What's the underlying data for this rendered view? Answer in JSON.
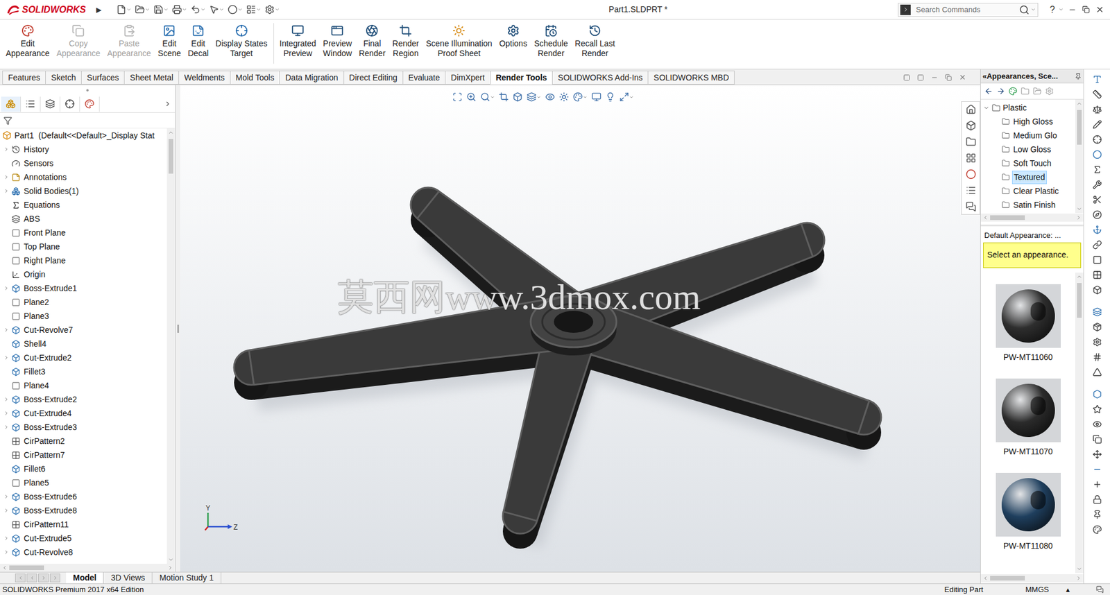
{
  "title_bar": {
    "logo": "SOLIDWORKS",
    "menu_arrow": "▶",
    "document": "Part1.SLDPRT *",
    "search_placeholder": "Search Commands",
    "help": "?"
  },
  "ribbon": [
    {
      "lines": [
        "Edit",
        "Appearance"
      ],
      "disabled": false
    },
    {
      "lines": [
        "Copy",
        "Appearance"
      ],
      "disabled": true
    },
    {
      "lines": [
        "Paste",
        "Appearance"
      ],
      "disabled": true
    },
    {
      "lines": [
        "Edit",
        "Scene"
      ],
      "disabled": false
    },
    {
      "lines": [
        "Edit",
        "Decal"
      ],
      "disabled": false
    },
    {
      "lines": [
        "Display States",
        "Target"
      ],
      "disabled": false
    },
    {
      "lines": [
        "Integrated",
        "Preview"
      ],
      "disabled": false
    },
    {
      "lines": [
        "Preview",
        "Window"
      ],
      "disabled": false
    },
    {
      "lines": [
        "Final",
        "Render"
      ],
      "disabled": false
    },
    {
      "lines": [
        "Render",
        "Region"
      ],
      "disabled": false
    },
    {
      "lines": [
        "Scene Illumination",
        "Proof Sheet"
      ],
      "disabled": false
    },
    {
      "lines": [
        "Options"
      ],
      "disabled": false
    },
    {
      "lines": [
        "Schedule",
        "Render"
      ],
      "disabled": false
    },
    {
      "lines": [
        "Recall Last",
        "Render"
      ],
      "disabled": false
    }
  ],
  "tabs": [
    {
      "label": "Features",
      "selected": false
    },
    {
      "label": "Sketch",
      "selected": false
    },
    {
      "label": "Surfaces",
      "selected": false
    },
    {
      "label": "Sheet Metal",
      "selected": false
    },
    {
      "label": "Weldments",
      "selected": false
    },
    {
      "label": "Mold Tools",
      "selected": false
    },
    {
      "label": "Data Migration",
      "selected": false
    },
    {
      "label": "Direct Editing",
      "selected": false
    },
    {
      "label": "Evaluate",
      "selected": false
    },
    {
      "label": "DimXpert",
      "selected": false
    },
    {
      "label": "Render Tools",
      "selected": true
    },
    {
      "label": "SOLIDWORKS Add-Ins",
      "selected": false
    },
    {
      "label": "SOLIDWORKS MBD",
      "selected": false
    }
  ],
  "feature_tree": {
    "root": "Part1  (Default<<Default>_Display Stat",
    "items": [
      {
        "label": "History",
        "kind": "history",
        "expandable": true
      },
      {
        "label": "Sensors",
        "kind": "sensor",
        "expandable": false
      },
      {
        "label": "Annotations",
        "kind": "annotation",
        "expandable": true
      },
      {
        "label": "Solid Bodies(1)",
        "kind": "bodies",
        "expandable": true
      },
      {
        "label": "Equations",
        "kind": "equations",
        "expandable": false
      },
      {
        "label": "ABS",
        "kind": "material",
        "expandable": false
      },
      {
        "label": "Front Plane",
        "kind": "plane",
        "expandable": false
      },
      {
        "label": "Top Plane",
        "kind": "plane",
        "expandable": false
      },
      {
        "label": "Right Plane",
        "kind": "plane",
        "expandable": false
      },
      {
        "label": "Origin",
        "kind": "origin",
        "expandable": false
      },
      {
        "label": "Boss-Extrude1",
        "kind": "feature",
        "expandable": true
      },
      {
        "label": "Plane2",
        "kind": "plane",
        "expandable": false
      },
      {
        "label": "Plane3",
        "kind": "plane",
        "expandable": false
      },
      {
        "label": "Cut-Revolve7",
        "kind": "feature",
        "expandable": true
      },
      {
        "label": "Shell4",
        "kind": "feature",
        "expandable": false
      },
      {
        "label": "Cut-Extrude2",
        "kind": "feature",
        "expandable": true
      },
      {
        "label": "Fillet3",
        "kind": "feature",
        "expandable": false
      },
      {
        "label": "Plane4",
        "kind": "plane",
        "expandable": false
      },
      {
        "label": "Boss-Extrude2",
        "kind": "feature",
        "expandable": true
      },
      {
        "label": "Cut-Extrude4",
        "kind": "feature",
        "expandable": true
      },
      {
        "label": "Boss-Extrude3",
        "kind": "feature",
        "expandable": true
      },
      {
        "label": "CirPattern2",
        "kind": "pattern",
        "expandable": false
      },
      {
        "label": "CirPattern7",
        "kind": "pattern",
        "expandable": false
      },
      {
        "label": "Fillet6",
        "kind": "feature",
        "expandable": false
      },
      {
        "label": "Plane5",
        "kind": "plane",
        "expandable": false
      },
      {
        "label": "Boss-Extrude6",
        "kind": "feature",
        "expandable": true
      },
      {
        "label": "Boss-Extrude8",
        "kind": "feature",
        "expandable": true
      },
      {
        "label": "CirPattern11",
        "kind": "pattern",
        "expandable": false
      },
      {
        "label": "Cut-Extrude5",
        "kind": "feature",
        "expandable": true
      },
      {
        "label": "Cut-Revolve8",
        "kind": "feature",
        "expandable": true
      }
    ]
  },
  "viewport": {
    "watermark": "莫西网www.3dmox.com",
    "triad": {
      "y": "Y",
      "z": "Z"
    }
  },
  "task_pane": {
    "title": "«Appearances, Sce...",
    "folder": {
      "label": "Plastic",
      "expanded": true
    },
    "items": [
      {
        "label": "High Gloss",
        "selected": false
      },
      {
        "label": "Medium Glo",
        "selected": false
      },
      {
        "label": "Low Gloss",
        "selected": false
      },
      {
        "label": "Soft Touch",
        "selected": false
      },
      {
        "label": "Textured",
        "selected": true
      },
      {
        "label": "Clear Plastic",
        "selected": false
      },
      {
        "label": "Satin Finish",
        "selected": false
      }
    ],
    "default_label": "Default Appearance: ...",
    "hint": "Select an appearance.",
    "swatches": [
      {
        "name": "PW-MT11060",
        "color": "#2e2e2e"
      },
      {
        "name": "PW-MT11070",
        "color": "#2b2b2b"
      },
      {
        "name": "PW-MT11080",
        "color": "#1f3f5e"
      }
    ]
  },
  "bottom_tabs": [
    {
      "label": "Model",
      "selected": true
    },
    {
      "label": "3D Views",
      "selected": false
    },
    {
      "label": "Motion Study 1",
      "selected": false
    }
  ],
  "status_bar": {
    "edition": "SOLIDWORKS Premium 2017 x64 Edition",
    "mode": "Editing Part",
    "units": "MMGS",
    "units_arrow": "▴"
  }
}
